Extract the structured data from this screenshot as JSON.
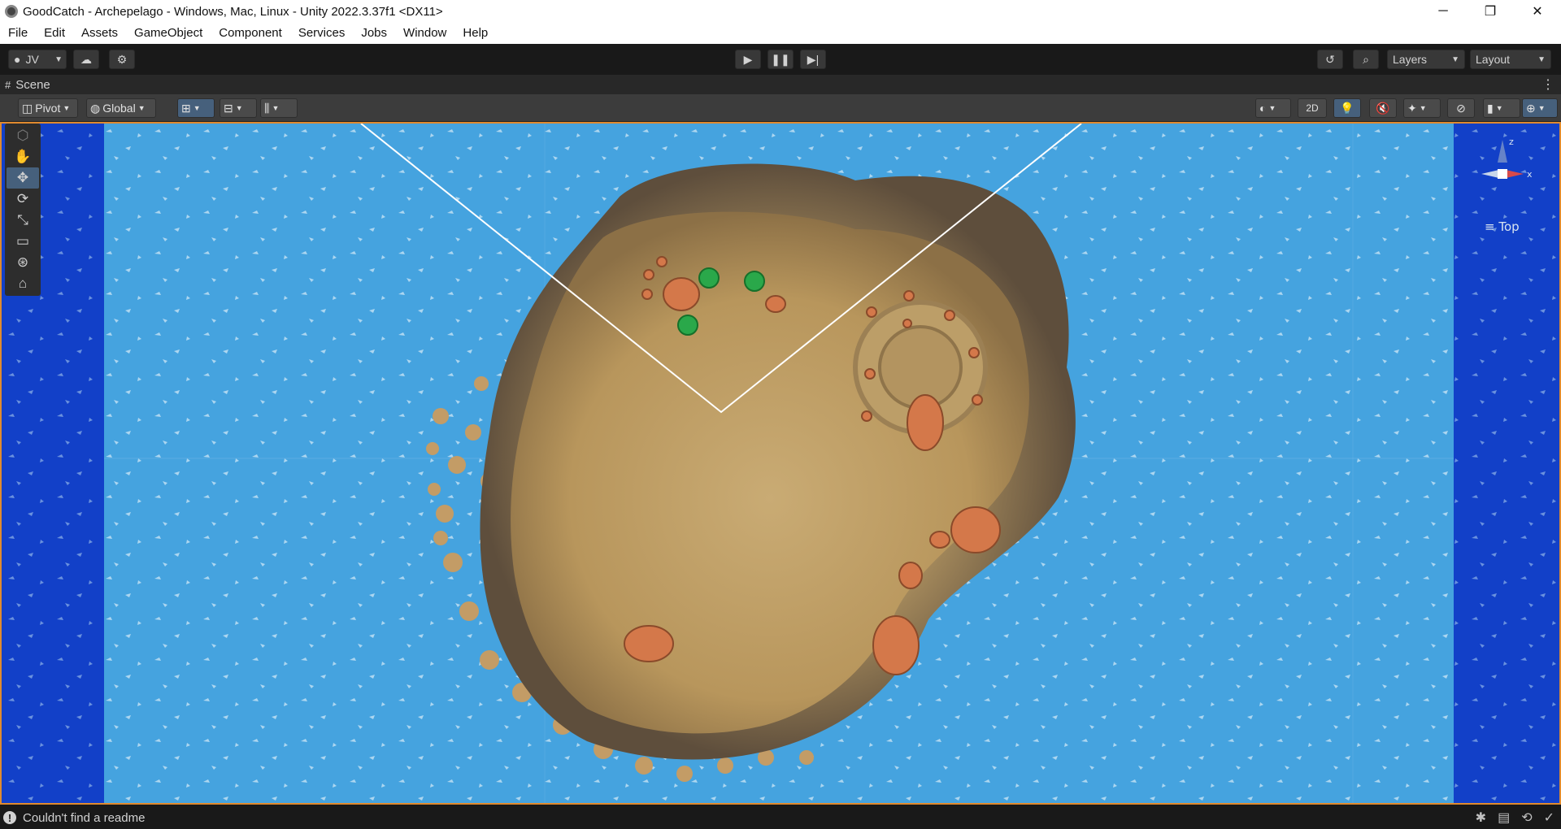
{
  "window": {
    "title": "GoodCatch - Archepelago - Windows, Mac, Linux - Unity 2022.3.37f1 <DX11>",
    "controls": {
      "minimize": "─",
      "maximize": "❐",
      "close": "✕"
    }
  },
  "menu": [
    "File",
    "Edit",
    "Assets",
    "GameObject",
    "Component",
    "Services",
    "Jobs",
    "Window",
    "Help"
  ],
  "toolbar": {
    "account_label": "JV",
    "layers_label": "Layers",
    "layout_label": "Layout"
  },
  "scene_tab": {
    "label": "Scene"
  },
  "scene_toolbar": {
    "pivot_label": "Pivot",
    "global_label": "Global",
    "mode_2d_label": "2D"
  },
  "gizmo": {
    "view_label": "Top",
    "axis_z": "z",
    "axis_x": "x"
  },
  "status": {
    "message": "Couldn't find a readme"
  },
  "colors": {
    "water": "#45a3df",
    "deep_water": "#1240c8",
    "sand": "#c8a76a",
    "rock": "#d4784a",
    "tree": "#2aa84a",
    "viewport_border": "#e08a2e"
  }
}
